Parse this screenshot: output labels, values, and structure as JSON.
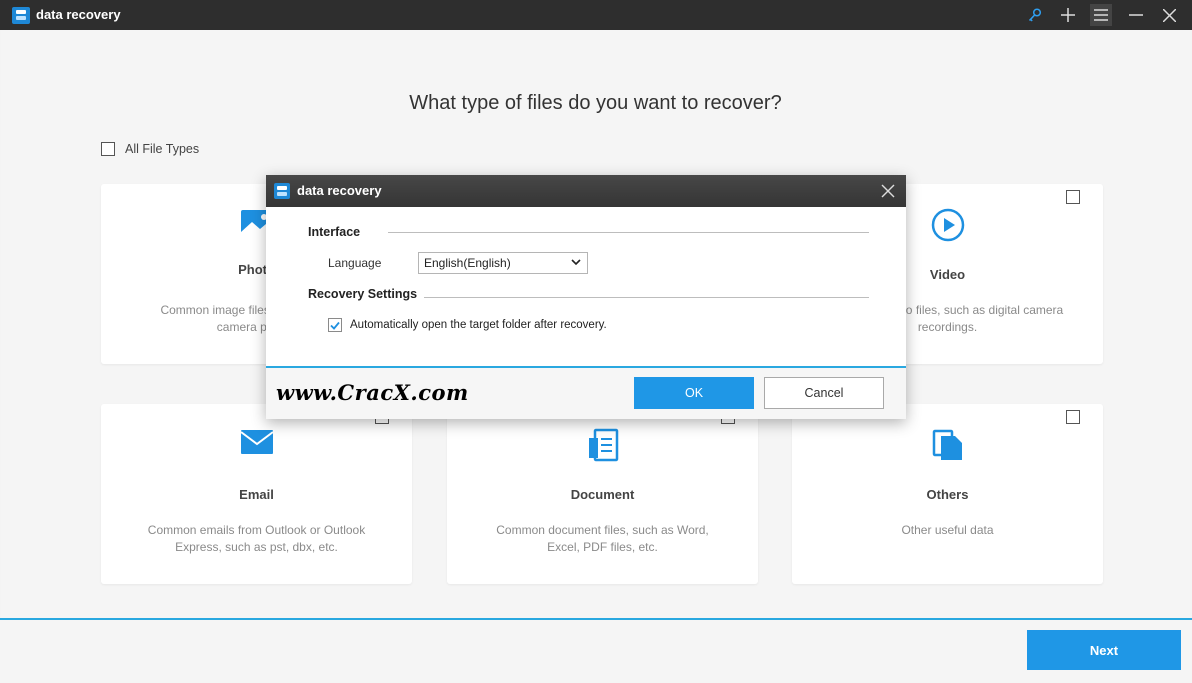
{
  "window": {
    "title": "data recovery",
    "icons": [
      "key-icon",
      "plus-icon",
      "menu-icon",
      "minimize-icon",
      "close-icon"
    ]
  },
  "main": {
    "heading": "What type of files do you want to recover?",
    "all_types_label": "All File Types",
    "cards": [
      {
        "title": "Photo",
        "desc": "Common image files, such as digital camera photos",
        "icon": "photo-icon"
      },
      {
        "title": "Video",
        "desc": "Common video files, such as digital camera recordings.",
        "icon": "video-play-icon"
      },
      {
        "title": "Email",
        "desc": "Common emails from Outlook or Outlook Express, such as pst, dbx, etc.",
        "icon": "envelope-icon"
      },
      {
        "title": "Document",
        "desc": "Common document files, such as Word, Excel, PDF files, etc.",
        "icon": "document-icon"
      },
      {
        "title": "Others",
        "desc": "Other useful data",
        "icon": "files-icon"
      }
    ]
  },
  "footer": {
    "next_label": "Next"
  },
  "dialog": {
    "title": "data recovery",
    "interface_label": "Interface",
    "language_label": "Language",
    "language_value": "English(English)",
    "recovery_label": "Recovery Settings",
    "auto_open_label": "Automatically open the target folder after recovery.",
    "auto_open_checked": true,
    "watermark": "www.CracX.com",
    "ok_label": "OK",
    "cancel_label": "Cancel"
  },
  "colors": {
    "accent": "#1f97e6",
    "titlebar": "#2e2e2e",
    "icon_blue": "#1e90e0"
  }
}
